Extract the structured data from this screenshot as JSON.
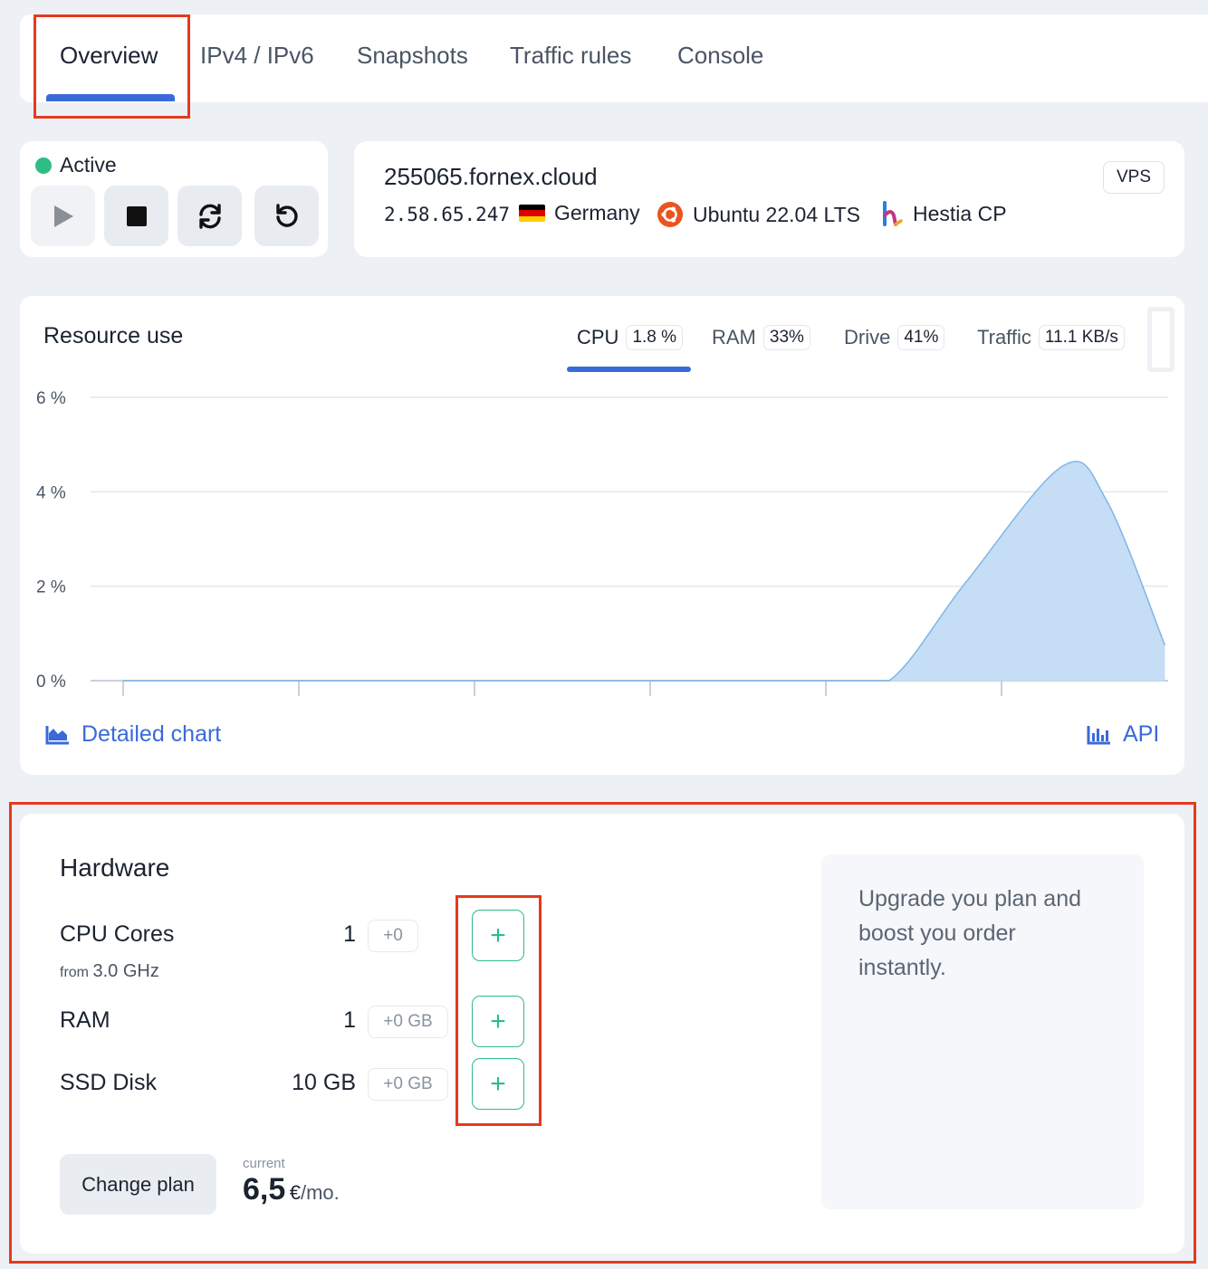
{
  "tabs": [
    {
      "label": "Overview",
      "active": true
    },
    {
      "label": "IPv4 / IPv6"
    },
    {
      "label": "Snapshots"
    },
    {
      "label": "Traffic rules"
    },
    {
      "label": "Console"
    }
  ],
  "status": {
    "label": "Active",
    "color": "#2ebd85",
    "controls": [
      {
        "icon": "play-icon",
        "disabled": true
      },
      {
        "icon": "stop-icon"
      },
      {
        "icon": "reinstall-icon"
      },
      {
        "icon": "restart-icon"
      }
    ]
  },
  "server": {
    "hostname": "255065.fornex.cloud",
    "ip": "2.58.65.247",
    "country": "Germany",
    "os": "Ubuntu 22.04 LTS",
    "panel": "Hestia CP",
    "type": "VPS"
  },
  "resources": {
    "title": "Resource use",
    "metrics": [
      {
        "label": "CPU",
        "value": "1.8 %",
        "active": true
      },
      {
        "label": "RAM",
        "value": "33%"
      },
      {
        "label": "Drive",
        "value": "41%"
      },
      {
        "label": "Traffic",
        "value": "11.1 KB/s"
      }
    ],
    "detailed_chart_label": "Detailed chart",
    "api_label": "API"
  },
  "chart_data": {
    "type": "area",
    "y_ticks": [
      "6 %",
      "4 %",
      "2 %",
      "0 %"
    ],
    "ylim": [
      0,
      6
    ],
    "xlim": [
      0,
      6
    ],
    "x": [
      0,
      1,
      2,
      3,
      4,
      4.36,
      4.8,
      5.35,
      5.6,
      5.93
    ],
    "values": [
      0,
      0,
      0,
      0,
      0,
      0,
      2.1,
      4.55,
      3.8,
      0.75
    ],
    "fill": "#c5ddf5",
    "stroke": "#7eb6e8"
  },
  "hardware": {
    "title": "Hardware",
    "rows": [
      {
        "label": "CPU Cores",
        "sub_from": "from",
        "sub_value": "3.0 GHz",
        "value": "1",
        "delta": "+0"
      },
      {
        "label": "RAM",
        "value": "1",
        "delta": "+0 GB"
      },
      {
        "label": "SSD Disk",
        "value": "10 GB",
        "delta": "+0 GB"
      }
    ],
    "add_label": "+",
    "change_plan_label": "Change plan",
    "price_caption": "current",
    "price_value": "6,5",
    "price_currency": "€",
    "price_period": "/mo.",
    "upgrade_text": "Upgrade you plan and boost you order instantly."
  }
}
